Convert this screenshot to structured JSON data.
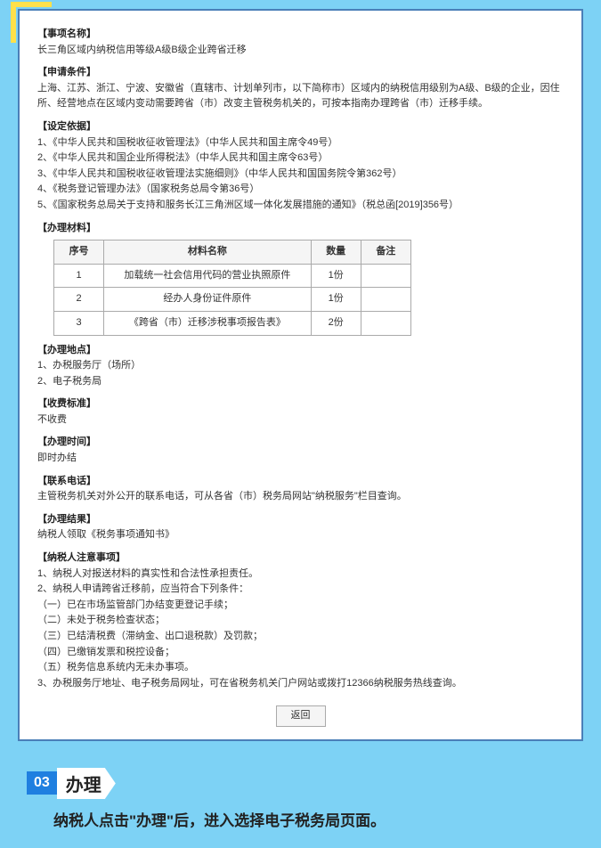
{
  "card": {
    "item_name_label": "【事项名称】",
    "item_name_body": "长三角区域内纳税信用等级A级B级企业跨省迁移",
    "conditions_label": "【申请条件】",
    "conditions_body": "上海、江苏、浙江、宁波、安徽省（直辖市、计划单列市，以下简称市）区域内的纳税信用级别为A级、B级的企业，因住所、经营地点在区域内变动需要跨省（市）改变主管税务机关的，可按本指南办理跨省（市）迁移手续。",
    "basis_label": "【设定依据】",
    "basis_lines": [
      "1、《中华人民共和国税收征收管理法》（中华人民共和国主席令49号）",
      "2、《中华人民共和国企业所得税法》（中华人民共和国主席令63号）",
      "3、《中华人民共和国税收征收管理法实施细则》（中华人民共和国国务院令第362号）",
      "4、《税务登记管理办法》（国家税务总局令第36号）",
      "5、《国家税务总局关于支持和服务长江三角洲区域一体化发展措施的通知》（税总函[2019]356号）"
    ],
    "materials_label": "【办理材料】",
    "materials_headers": [
      "序号",
      "材料名称",
      "数量",
      "备注"
    ],
    "materials_rows": [
      {
        "no": "1",
        "name": "加载统一社会信用代码的营业执照原件",
        "qty": "1份",
        "remark": ""
      },
      {
        "no": "2",
        "name": "经办人身份证件原件",
        "qty": "1份",
        "remark": ""
      },
      {
        "no": "3",
        "name": "《跨省（市）迁移涉税事项报告表》",
        "qty": "2份",
        "remark": ""
      }
    ],
    "place_label": "【办理地点】",
    "place_lines": [
      "1、办税服务厅（场所）",
      "2、电子税务局"
    ],
    "fee_label": "【收费标准】",
    "fee_body": "不收费",
    "time_label": "【办理时间】",
    "time_body": "即时办结",
    "phone_label": "【联系电话】",
    "phone_body": "主管税务机关对外公开的联系电话，可从各省（市）税务局网站\"纳税服务\"栏目查询。",
    "result_label": "【办理结果】",
    "result_body": "纳税人领取《税务事项通知书》",
    "notice_label": "【纳税人注意事项】",
    "notice_lines": [
      "1、纳税人对报送材料的真实性和合法性承担责任。",
      "2、纳税人申请跨省迁移前，应当符合下列条件：",
      "（一）已在市场监管部门办结变更登记手续；",
      "（二）未处于税务检查状态；",
      "（三）已结清税费（滞纳金、出口退税款）及罚款；",
      "（四）已缴销发票和税控设备；",
      "（五）税务信息系统内无未办事项。",
      "3、办税服务厅地址、电子税务局网址，可在省税务机关门户网站或拨打12366纳税服务热线查询。"
    ],
    "back_btn": "返回"
  },
  "step": {
    "num": "03",
    "title": "办理",
    "desc": "纳税人点击\"办理\"后，进入选择电子税务局页面。"
  }
}
